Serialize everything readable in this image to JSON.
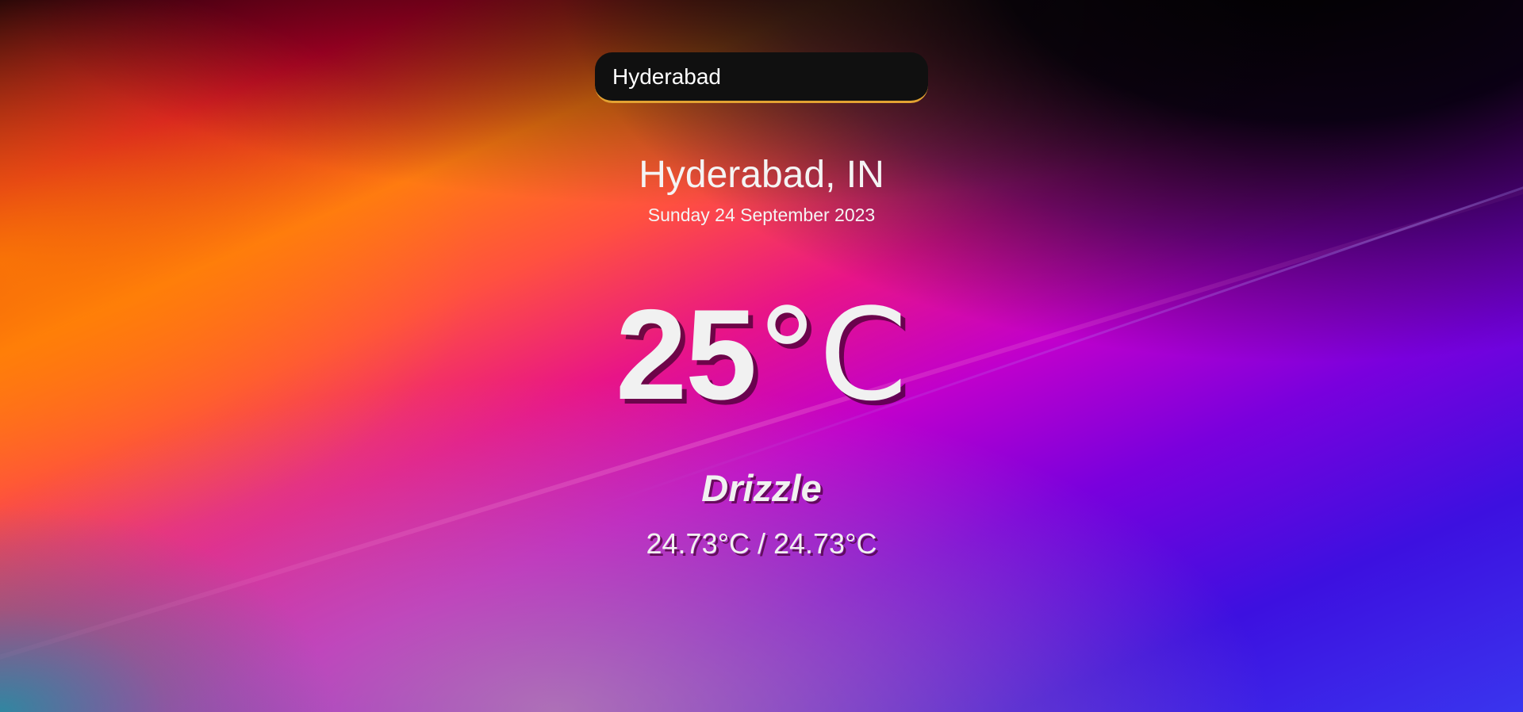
{
  "search": {
    "value": "Hyderabad",
    "placeholder": ""
  },
  "weather": {
    "location": "Hyderabad, IN",
    "date": "Sunday 24 September 2023",
    "temperature": "25",
    "temperature_unit": "°C",
    "condition": "Drizzle",
    "hi_lo": "24.73°C / 24.73°C"
  },
  "colors": {
    "search_background": "#101010",
    "search_accent": "#e2a232",
    "text": "#f1f1f1"
  }
}
